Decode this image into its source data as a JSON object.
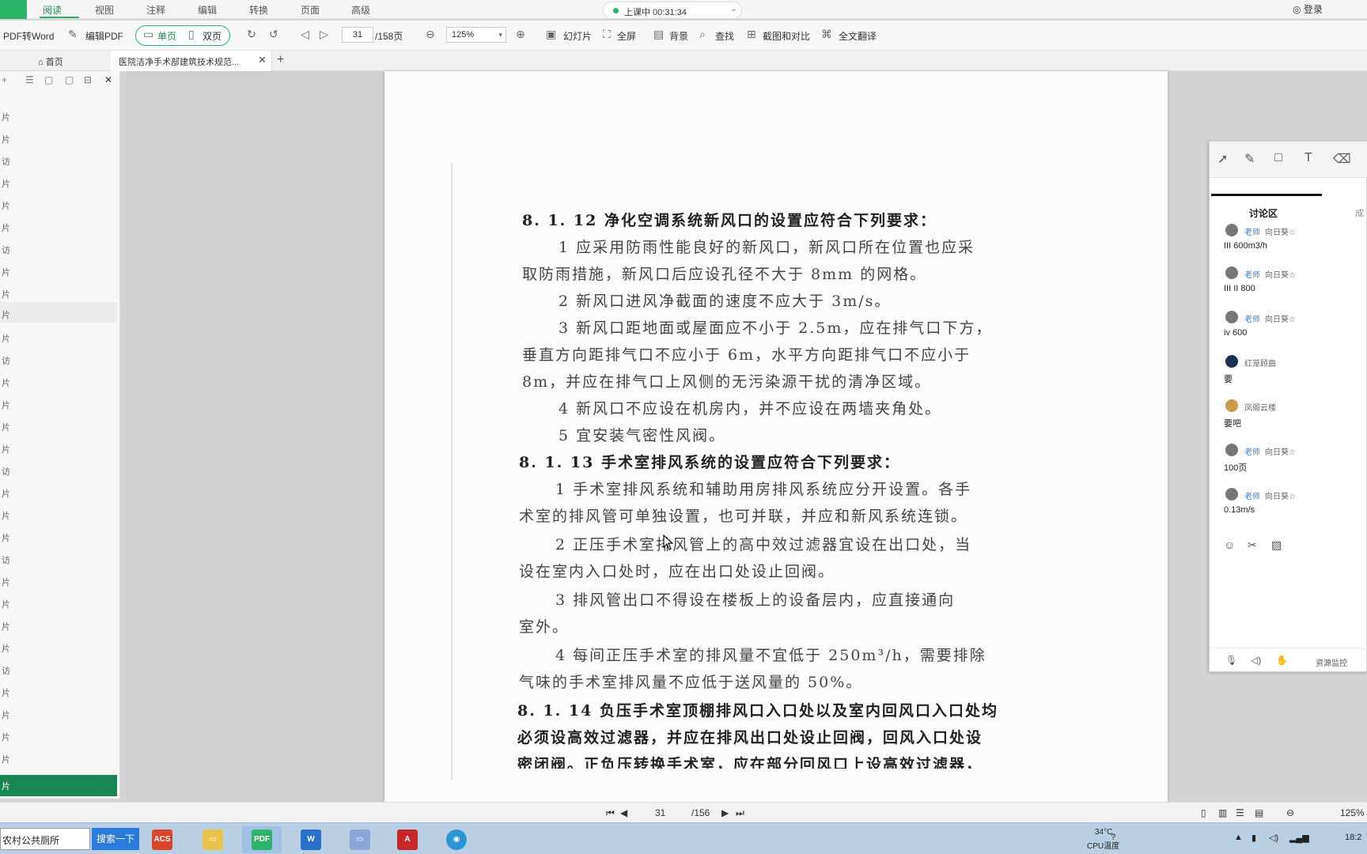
{
  "menubar": {
    "menus": [
      "阅读",
      "视图",
      "注释",
      "编辑",
      "转换",
      "页面",
      "高级"
    ],
    "live_status": "上课中 00:31:34",
    "login": "登录"
  },
  "toolbar": {
    "pdf_to_word": "PDF转Word",
    "edit_pdf": "编辑PDF",
    "single_page": "单页",
    "double_page": "双页",
    "current_page": "31",
    "total_pages": "/158页",
    "zoom": "125%",
    "slideshow": "幻灯片",
    "fullscreen": "全屏",
    "background": "背景",
    "find": "查找",
    "screenshot_compare": "截图和对比",
    "full_translate": "全文翻译"
  },
  "tabs": {
    "home": "首页",
    "document": "医院洁净手术部建筑技术规范..."
  },
  "sidebar": {
    "thumb_label": "片",
    "thumb_label_alt": "访"
  },
  "document": {
    "lines": [
      "8. 1. 12   净化空调系统新风口的设置应符合下列要求：",
      "1   应采用防雨性能良好的新风口，新风口所在位置也应采",
      "取防雨措施，新风口后应设孔径不大于 8mm 的网格。",
      "2   新风口进风净截面的速度不应大于 3m/s。",
      "3   新风口距地面或屋面应不小于 2.5m，应在排气口下方，",
      "垂直方向距排气口不应小于 6m，水平方向距排气口不应小于",
      "8m，并应在排气口上风侧的无污染源干扰的清净区域。",
      "4   新风口不应设在机房内，并不应设在两墙夹角处。",
      "5   宜安装气密性风阀。",
      "8. 1. 13   手术室排风系统的设置应符合下列要求：",
      "1   手术室排风系统和辅助用房排风系统应分开设置。各手",
      "术室的排风管可单独设置，也可并联，并应和新风系统连锁。",
      "2   正压手术室排风管上的高中效过滤器宜设在出口处，当",
      "设在室内入口处时，应在出口处设止回阀。",
      "3   排风管出口不得设在楼板上的设备层内，应直接通向",
      "室外。",
      "4   每间正压手术室的排风量不宜低于 250m³/h，需要排除",
      "气味的手术室排风量不应低于送风量的 50%。",
      "8. 1. 14   负压手术室顶棚排风口入口处以及室内回风口入口处均",
      "必须设高效过滤器，并应在排风出口处设止回阀，回风入口处设",
      "密闭阀。正负压转换手术室，应在部分回风口上设高效过滤器，"
    ]
  },
  "discussion": {
    "title": "讨论区",
    "second_tab": "成",
    "messages": [
      {
        "role": "老师",
        "user": "向日葵☆",
        "text": "III 600m3/h",
        "avatar_color": "#6b6b6b"
      },
      {
        "role": "老师",
        "user": "向日葵☆",
        "text": "III II 800",
        "avatar_color": "#6b6b6b"
      },
      {
        "role": "老师",
        "user": "向日葵☆",
        "text": "iv 600",
        "avatar_color": "#6b6b6b"
      },
      {
        "role": "",
        "user": "红笼顾曲",
        "text": "要",
        "avatar_color": "#1a3050"
      },
      {
        "role": "",
        "user": "凤阁云楼",
        "text": "要吧",
        "avatar_color": "#c99b4e"
      },
      {
        "role": "老师",
        "user": "向日葵☆",
        "text": "100页",
        "avatar_color": "#6b6b6b"
      },
      {
        "role": "老师",
        "user": "向日葵☆",
        "text": "0.13m/s",
        "avatar_color": "#6b6b6b"
      }
    ],
    "resource_monitor": "资源监控"
  },
  "statusbar": {
    "page": "31",
    "total": "/156",
    "zoom": "125%"
  },
  "taskbar": {
    "search_text": "农村公共厕所",
    "search_button": "搜索一下",
    "temperature": "34°C",
    "cpu": "CPU温度",
    "time": "18:2"
  },
  "colors": {
    "accent": "#2eb36b",
    "sidebar_green": "#198754"
  }
}
